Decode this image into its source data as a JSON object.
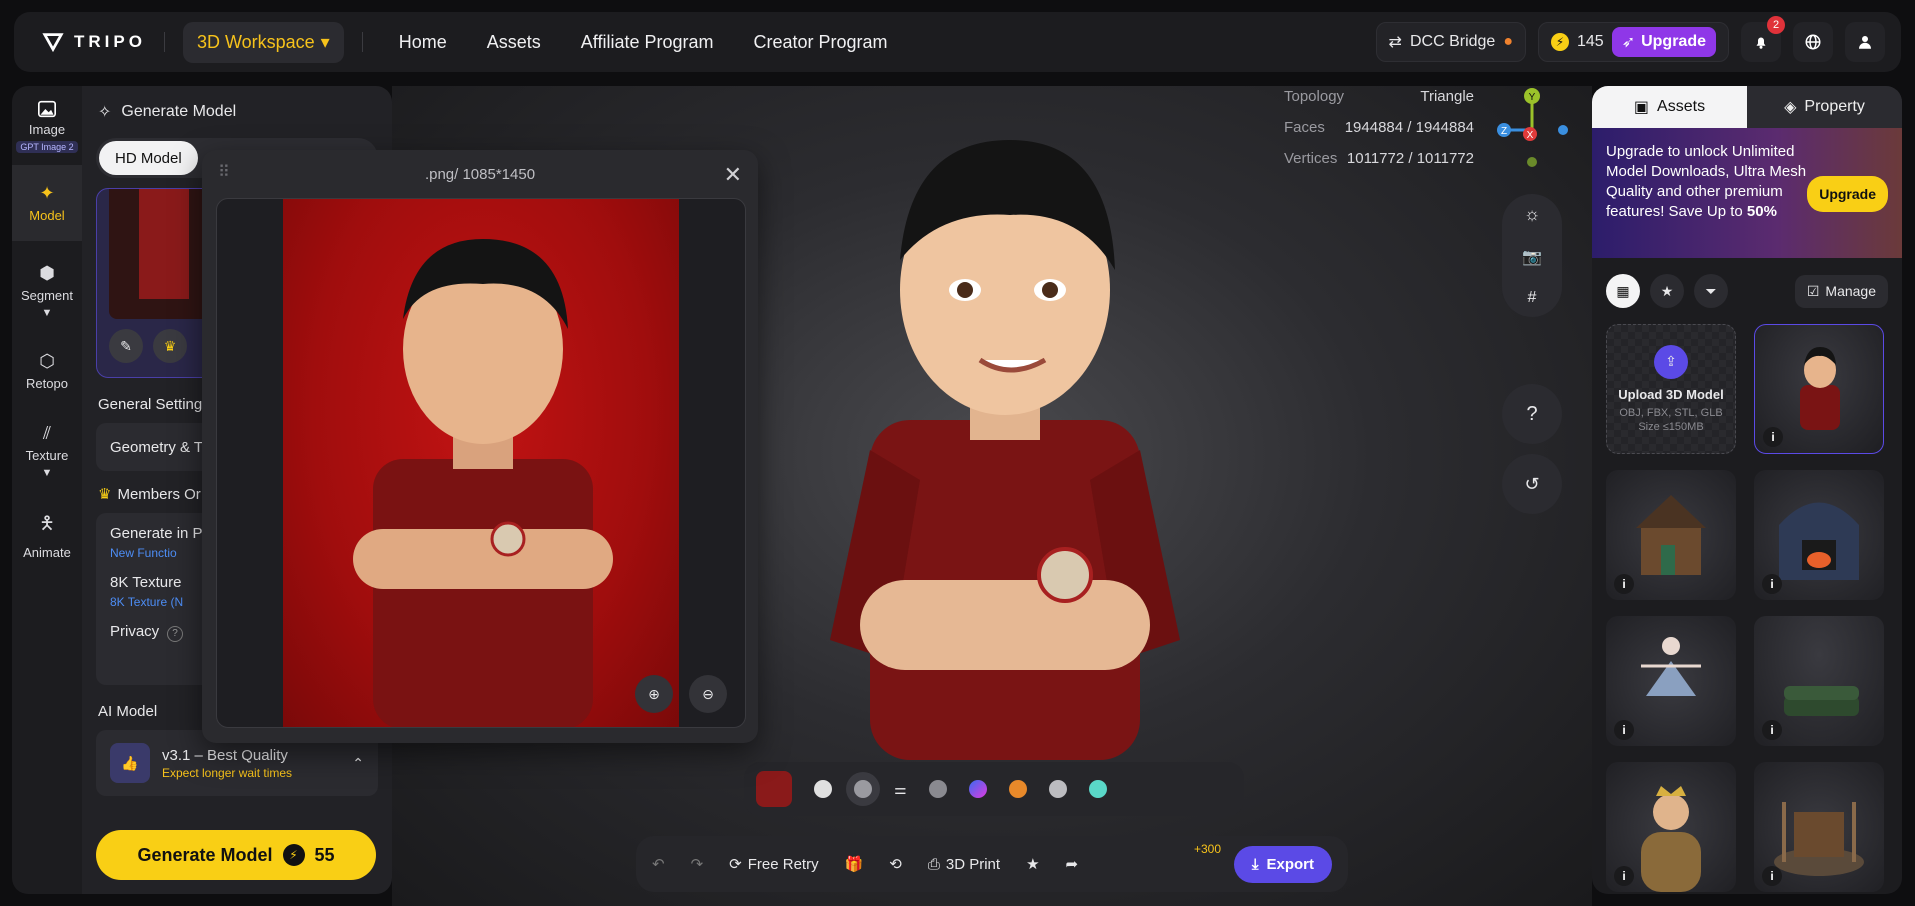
{
  "header": {
    "logo_text": "TRIPO",
    "workspace": "3D Workspace",
    "nav": [
      "Home",
      "Assets",
      "Affiliate Program",
      "Creator Program"
    ],
    "dcc_bridge": "DCC Bridge",
    "credits": "145",
    "upgrade": "Upgrade",
    "notifications_count": "2"
  },
  "rail": {
    "image": "Image",
    "image_tag": "GPT Image 2",
    "model": "Model",
    "segment": "Segment",
    "retopo": "Retopo",
    "texture": "Texture",
    "animate": "Animate"
  },
  "panel": {
    "title": "Generate Model",
    "tab_hd": "HD Model",
    "general_settings": "General Setting",
    "geometry": "Geometry & T",
    "members_only": "Members Or",
    "gen_in": "Generate in P",
    "new_function": "New Functio",
    "texture_8k": "8K Texture",
    "texture_8k_sub": "8K Texture (N",
    "privacy": "Privacy",
    "ai_model_label": "AI Model",
    "ai_model_name": "v3.1 – Best Quality",
    "ai_model_sub": "Expect longer wait times",
    "generate_button": "Generate Model",
    "generate_cost": "55"
  },
  "preview": {
    "title": ".png/ 1085*1450"
  },
  "stats": {
    "topology_label": "Topology",
    "topology_value": "Triangle",
    "faces_label": "Faces",
    "faces_value": "1944884 / 1944884",
    "vertices_label": "Vertices",
    "vertices_value": "1011772 / 1011772"
  },
  "gizmo": {
    "y": "Y",
    "z": "Z",
    "x": "X"
  },
  "bottombar": {
    "free_retry": "Free Retry",
    "print": "3D Print",
    "plus": "+300",
    "export": "Export"
  },
  "right": {
    "tab_assets": "Assets",
    "tab_property": "Property",
    "promo_text_1": "Upgrade to unlock Unlimited Model Downloads, Ultra Mesh Quality and other premium features!  Save Up to ",
    "promo_percent": "50%",
    "promo_button": "Upgrade",
    "manage": "Manage",
    "upload_title": "Upload 3D Model",
    "upload_formats": "OBJ, FBX, STL, GLB",
    "upload_size": "Size ≤150MB"
  },
  "colors": {
    "accent_yellow": "#f9cf15",
    "accent_purple": "#5b4ae6",
    "upgrade_purple": "#8f37e8"
  }
}
